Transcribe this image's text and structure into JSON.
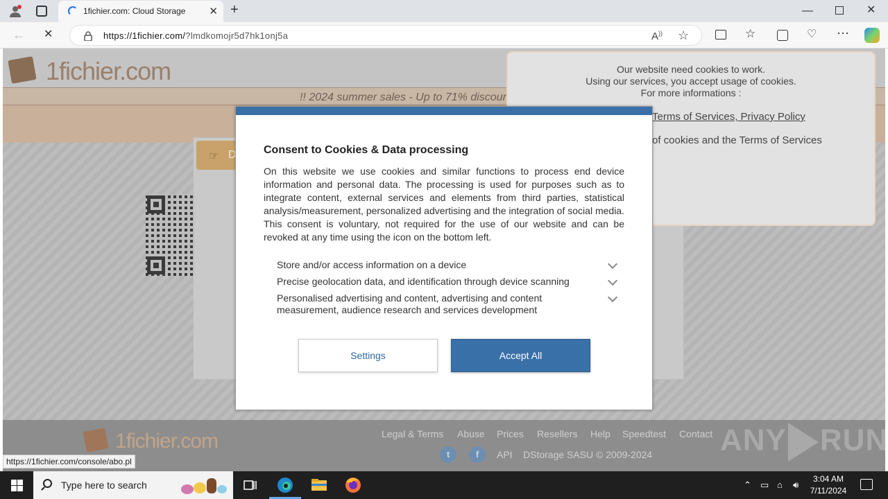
{
  "browser": {
    "tab_title": "1fichier.com: Cloud Storage",
    "url_host": "https://1fichier.com/",
    "url_rest": "?lmdkomojr5d7hk1onj5a",
    "status_url": "https://1fichier.com/console/abo.pl"
  },
  "page": {
    "logo_text": "1fichier.com",
    "sales_banner": "!! 2024 summer sales - Up to 71% discount",
    "download_button": "D"
  },
  "cookie_notice": {
    "line1": "Our website need cookies to work.",
    "line2": "Using our services, you accept usage of cookies.",
    "line3": "For more informations :",
    "links": "Terms of Services, Privacy Policy",
    "accept_text": "of cookies and the Terms of Services"
  },
  "consent_modal": {
    "title": "Consent to Cookies & Data processing",
    "body": "On this website we use cookies and similar functions to process end device information and personal data. The processing is used for purposes such as to integrate content, external services and elements from third parties, statistical analysis/measurement, personalized advertising and the integration of social media. This consent is voluntary, not required for the use of our website and can be revoked at any time using the icon on the bottom left.",
    "purposes": [
      "Store and/or access information on a device",
      "Precise geolocation data, and identification through device scanning",
      "Personalised advertising and content, advertising and content measurement, audience research and services development"
    ],
    "settings_label": "Settings",
    "accept_label": "Accept All"
  },
  "footer": {
    "logo_text": "1fichier.com",
    "links": [
      "Legal & Terms",
      "Abuse",
      "Prices",
      "Resellers",
      "Help",
      "Speedtest",
      "Contact"
    ],
    "api": "API",
    "copyright": "DStorage SASU © 2009-2024",
    "watermark_any": "ANY",
    "watermark_run": "RUN"
  },
  "taskbar": {
    "search_placeholder": "Type here to search",
    "time": "3:04 AM",
    "date": "7/11/2024"
  },
  "colors": {
    "accent_blue": "#3a70a8",
    "brand_brown": "#9b7f6a"
  }
}
